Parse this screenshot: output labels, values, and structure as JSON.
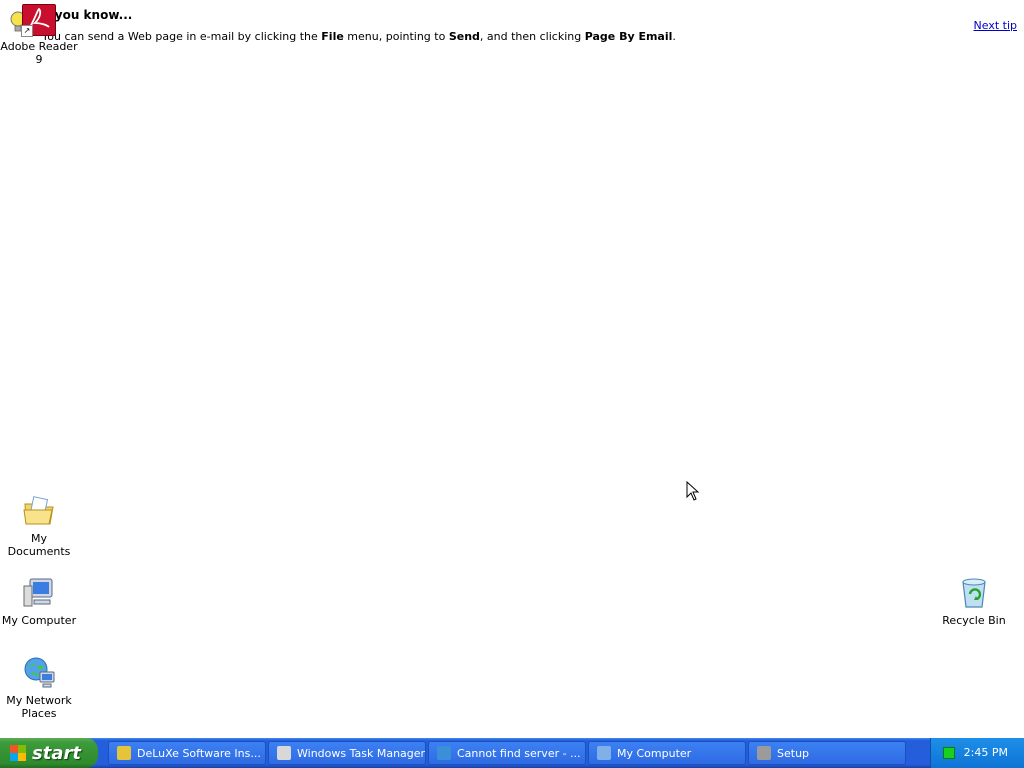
{
  "tip": {
    "title": "d you know...",
    "text_parts": [
      {
        "t": "You can send a Web page in e-mail by clicking the ",
        "b": false
      },
      {
        "t": "File",
        "b": true
      },
      {
        "t": " menu, pointing to ",
        "b": false
      },
      {
        "t": "Send",
        "b": true
      },
      {
        "t": ", and then clicking ",
        "b": false
      },
      {
        "t": "Page By Email",
        "b": true
      },
      {
        "t": ".",
        "b": false
      }
    ],
    "next_tip": "Next tip"
  },
  "desktop_icons": {
    "adobe": {
      "label": "Adobe Reader 9",
      "icon": "adobe-reader-icon"
    },
    "my_documents": {
      "label": "My Documents",
      "icon": "folder-documents-icon"
    },
    "my_computer": {
      "label": "My Computer",
      "icon": "computer-icon"
    },
    "my_network": {
      "label": "My Network Places",
      "icon": "network-places-icon"
    },
    "recycle_bin": {
      "label": "Recycle Bin",
      "icon": "recycle-bin-icon"
    }
  },
  "taskbar": {
    "start_label": "start",
    "buttons": [
      {
        "label": "DeLuXe Software Ins...",
        "icon": "installer-icon",
        "color": "#e3c43a"
      },
      {
        "label": "Windows Task Manager",
        "icon": "task-manager-icon",
        "color": "#d8d8d8"
      },
      {
        "label": "Cannot find server - ...",
        "icon": "ie-icon",
        "color": "#3a8fd8"
      },
      {
        "label": "My Computer",
        "icon": "computer-icon",
        "color": "#7fb0e8"
      },
      {
        "label": "Setup",
        "icon": "setup-icon",
        "color": "#9b9b9b"
      }
    ],
    "clock": "2:45 PM"
  },
  "colors": {
    "taskbar_blue": "#245edb",
    "start_green": "#3c9b3a",
    "tray_blue": "#0e74d6",
    "link_blue": "#0000cc"
  }
}
